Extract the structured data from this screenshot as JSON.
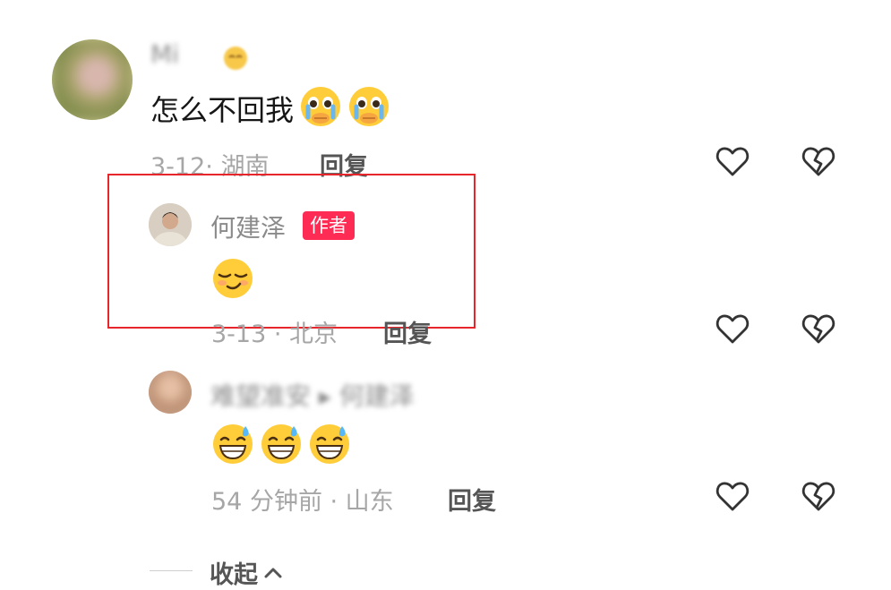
{
  "comments": [
    {
      "username": "Mi",
      "text": "怎么不回我",
      "emojis": [
        "crying-pleading-emoji",
        "crying-pleading-emoji"
      ],
      "meta": "3-12· 湖南",
      "reply_label": "回复"
    }
  ],
  "replies": [
    {
      "username": "何建泽",
      "badge": "作者",
      "emojis": [
        "smirk-emoji"
      ],
      "meta": "3-13 · 北京",
      "reply_label": "回复",
      "highlighted": true
    },
    {
      "username": "难望准安 ▸ 何建泽",
      "emojis": [
        "grinning-sweat-emoji",
        "grinning-sweat-emoji",
        "grinning-sweat-emoji"
      ],
      "meta": "54 分钟前 · 山东",
      "reply_label": "回复"
    }
  ],
  "collapse_label": "收起",
  "colors": {
    "author_badge": "#fe2c55",
    "highlight_border": "#e6262b",
    "meta_text": "#a6a6a6"
  },
  "icons": [
    "heart-outline-icon",
    "broken-heart-icon",
    "chevron-up-icon"
  ]
}
